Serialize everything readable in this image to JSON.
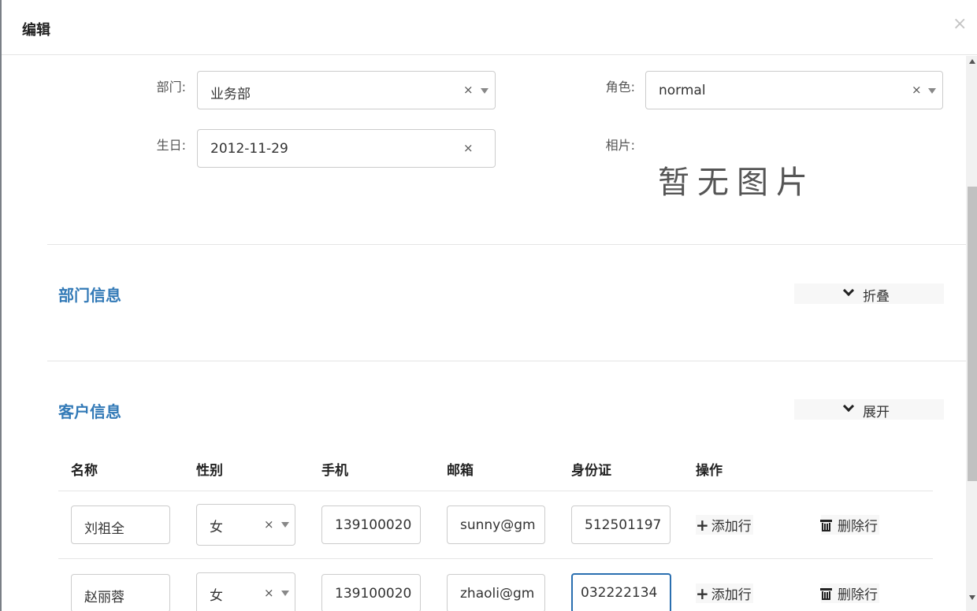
{
  "dialog": {
    "title": "编辑",
    "close_label": "×"
  },
  "form": {
    "dept": {
      "label": "部门:",
      "value": "业务部",
      "clear": "×"
    },
    "role": {
      "label": "角色:",
      "value": "normal",
      "clear": "×"
    },
    "birthday": {
      "label": "生日:",
      "value": "2012-11-29",
      "clear": "×"
    },
    "photo": {
      "label": "相片:",
      "placeholder": "暂无图片"
    }
  },
  "sections": {
    "dept_info": {
      "title": "部门信息",
      "toggle_label": "折叠"
    },
    "customer_info": {
      "title": "客户信息",
      "toggle_label": "展开"
    }
  },
  "customer_table": {
    "headers": [
      "名称",
      "性别",
      "手机",
      "邮箱",
      "身份证",
      "操作"
    ],
    "rows": [
      {
        "name": "刘祖全",
        "gender": "女",
        "phone": "139100020",
        "email": "sunny@gm",
        "id_card": "512501197",
        "add_label": "添加行",
        "delete_label": "删除行"
      },
      {
        "name": "赵丽蓉",
        "gender": "女",
        "phone": "139100020",
        "email": "zhaoli@gm",
        "id_card": "032222134",
        "add_label": "添加行",
        "delete_label": "删除行"
      }
    ],
    "clear": "×"
  },
  "colors": {
    "section_title": "#337ab7",
    "focus_border": "#2a6fb0"
  }
}
